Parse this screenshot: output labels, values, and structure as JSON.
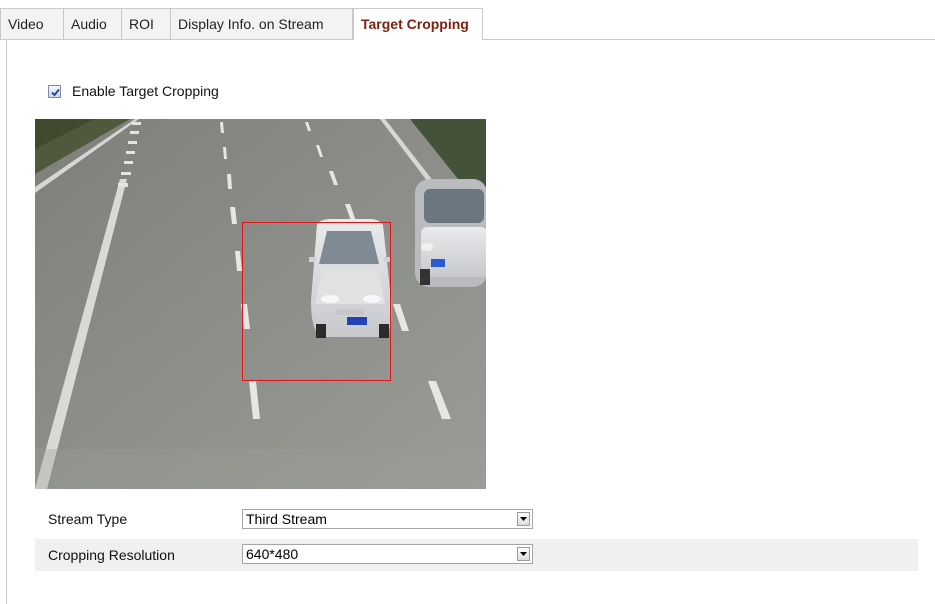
{
  "tabs": [
    {
      "label": "Video",
      "active": false
    },
    {
      "label": "Audio",
      "active": false
    },
    {
      "label": "ROI",
      "active": false
    },
    {
      "label": "Display Info. on Stream",
      "active": false
    },
    {
      "label": "Target Cropping",
      "active": true
    }
  ],
  "enable_target_cropping": {
    "label": "Enable Target Cropping",
    "checked": true
  },
  "stream_type": {
    "label": "Stream Type",
    "value": "Third Stream"
  },
  "cropping_resolution": {
    "label": "Cropping Resolution",
    "value": "640*480"
  },
  "colors": {
    "active_tab_text": "#7a2310",
    "crop_box": "#e0151a"
  }
}
